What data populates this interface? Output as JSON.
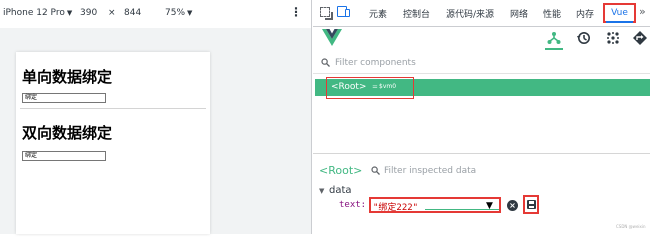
{
  "device_toolbar": {
    "device": "iPhone 12 Pro",
    "width": "390",
    "times": "×",
    "height": "844",
    "zoom": "75%"
  },
  "page": {
    "heading_one_way": "单向数据绑定",
    "input_one_way": "绑定",
    "heading_two_way": "双向数据绑定",
    "input_two_way": "绑定"
  },
  "devtools_tabs": [
    "元素",
    "控制台",
    "源代码/来源",
    "网络",
    "性能",
    "内存"
  ],
  "devtools_active_tab": "Vue",
  "vue": {
    "filter_components_placeholder": "Filter components",
    "root_tag": "<Root>",
    "root_eq": "=",
    "root_vm": "$vm0",
    "inspected_label": "<Root>",
    "filter_inspected_placeholder": "Filter inspected data",
    "data_section_label": "data",
    "prop_key": "text:",
    "prop_value": "\"绑定222\""
  },
  "watermark": "CSDN @weixin",
  "colors": {
    "vue_green": "#42b883",
    "highlight_red": "#e53935",
    "active_blue": "#1a73e8"
  },
  "icons": [
    "inspect-icon",
    "device-toggle-icon",
    "vue-logo-icon",
    "components-tree-icon",
    "history-icon",
    "vuex-icon",
    "events-icon",
    "search-icon",
    "save-icon",
    "cancel-icon"
  ]
}
